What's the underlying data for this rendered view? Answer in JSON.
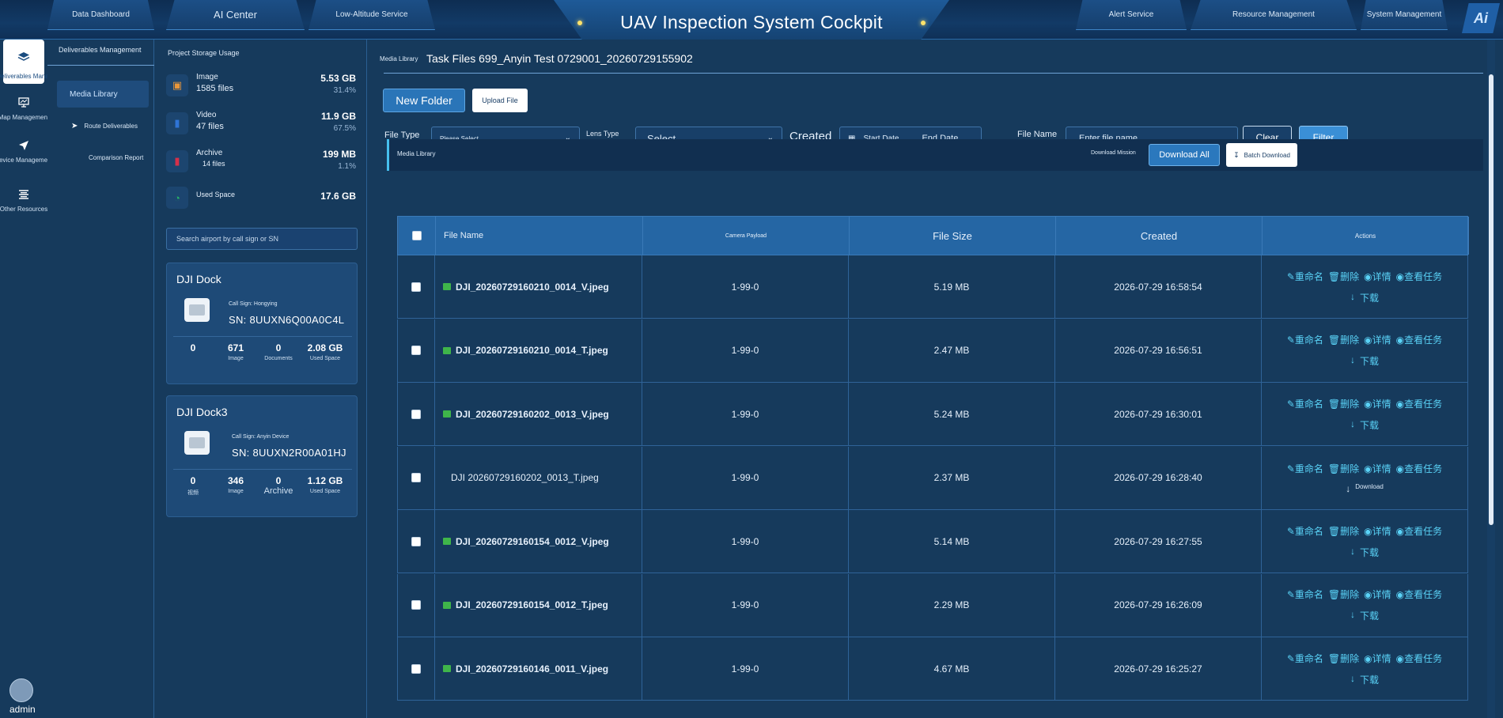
{
  "app": {
    "title": "UAV Inspection System Cockpit",
    "logo_text": "Ai",
    "nav_tabs": [
      {
        "label": "Data Dashboard"
      },
      {
        "label": "AI Center"
      },
      {
        "label": "Low-Altitude Service"
      },
      {
        "label": "Alert Service"
      },
      {
        "label": "Resource Management"
      },
      {
        "label": "System Management"
      }
    ]
  },
  "rail": {
    "items": [
      {
        "label": "Deliverables Management",
        "icon": "layers-icon"
      },
      {
        "label": "Map Management",
        "icon": "monitor-icon"
      },
      {
        "label": "Device Management",
        "icon": "plane-icon"
      },
      {
        "label": "Other Resources",
        "icon": "list-icon"
      }
    ]
  },
  "submenu": {
    "title": "Deliverables Management",
    "items": [
      {
        "label": "Media Library"
      },
      {
        "label": "Route Deliverables"
      },
      {
        "label": "Comparison Report"
      }
    ]
  },
  "storage": {
    "title": "Project Storage Usage",
    "rows": [
      {
        "name": "Image",
        "count": "1585 files",
        "size": "5.53 GB",
        "pct": "31.4%",
        "icon": "image-icon",
        "color": "#e8963a"
      },
      {
        "name": "Video",
        "count": "47 files",
        "size": "11.9 GB",
        "pct": "67.5%",
        "icon": "video-icon",
        "color": "#2f74d6"
      },
      {
        "name": "Archive",
        "count": "14 files",
        "size": "199 MB",
        "pct": "1.1%",
        "icon": "archive-icon",
        "color": "#d6304a"
      },
      {
        "name": "Used Space",
        "count": "",
        "size": "17.6 GB",
        "pct": "",
        "icon": "pie-icon",
        "color": "#26b267"
      }
    ],
    "search_placeholder": "Search airport by call sign or SN",
    "docks": [
      {
        "name": "DJI Dock",
        "call_sign": "Call Sign: Hongying",
        "sn": "SN:  8UUXN6Q00A0C4L",
        "stats": [
          {
            "value": "0",
            "label": ""
          },
          {
            "value": "671",
            "label": "Image"
          },
          {
            "value": "0",
            "label": "Documents"
          },
          {
            "value": "2.08 GB",
            "label": "Used Space"
          }
        ]
      },
      {
        "name": "DJI Dock3",
        "call_sign": "Call Sign: Anyin Device",
        "sn": "SN:  8UUXN2R00A01HJ",
        "stats": [
          {
            "value": "0",
            "label": "视频"
          },
          {
            "value": "346",
            "label": "Image"
          },
          {
            "value": "0",
            "label": "Archive"
          },
          {
            "value": "1.12 GB",
            "label": "Used Space"
          }
        ]
      }
    ]
  },
  "user": {
    "name": "admin"
  },
  "main": {
    "crumb_label": "Media Library",
    "crumb_title": "Task Files 699_Anyin Test 0729001_20260729155902",
    "new_folder": "New Folder",
    "upload_file": "Upload File",
    "filters": {
      "file_type_label": "File Type",
      "file_type_value": "Please Select",
      "lens_type_label": "Lens Type",
      "lens_type_value": "Select",
      "created_label": "Created",
      "start_date": "Start Date",
      "end_date": "End Date",
      "file_name_label": "File Name",
      "file_name_placeholder": "Enter file name",
      "clear": "Clear",
      "filter": "Filter"
    },
    "lib_bar": {
      "label": "Media Library",
      "download_mission": "Download Mission",
      "download_all": "Download All",
      "batch_download": "Batch Download"
    },
    "table": {
      "headers": {
        "file_name": "File Name",
        "camera_payload": "Camera Payload",
        "file_size": "File Size",
        "created": "Created",
        "actions": "Actions"
      },
      "actions": {
        "rename": "重命名",
        "delete": "删除",
        "details": "详情",
        "view_task": "查看任务",
        "download": "下载",
        "download_en": "Download"
      },
      "rows": [
        {
          "name": "DJI_20260729160210_0014_V.jpeg",
          "camera": "1-99-0",
          "size": "5.19 MB",
          "created": "2026-07-29 16:58:54"
        },
        {
          "name": "DJI_20260729160210_0014_T.jpeg",
          "camera": "1-99-0",
          "size": "2.47 MB",
          "created": "2026-07-29 16:56:51"
        },
        {
          "name": "DJI_20260729160202_0013_V.jpeg",
          "camera": "1-99-0",
          "size": "5.24 MB",
          "created": "2026-07-29 16:30:01"
        },
        {
          "name": "DJI 20260729160202_0013_T.jpeg",
          "camera": "1-99-0",
          "size": "2.37 MB",
          "created": "2026-07-29 16:28:40"
        },
        {
          "name": "DJI_20260729160154_0012_V.jpeg",
          "camera": "1-99-0",
          "size": "5.14 MB",
          "created": "2026-07-29 16:27:55"
        },
        {
          "name": "DJI_20260729160154_0012_T.jpeg",
          "camera": "1-99-0",
          "size": "2.29 MB",
          "created": "2026-07-29 16:26:09"
        },
        {
          "name": "DJI_20260729160146_0011_V.jpeg",
          "camera": "1-99-0",
          "size": "4.67 MB",
          "created": "2026-07-29 16:25:27"
        }
      ]
    }
  }
}
